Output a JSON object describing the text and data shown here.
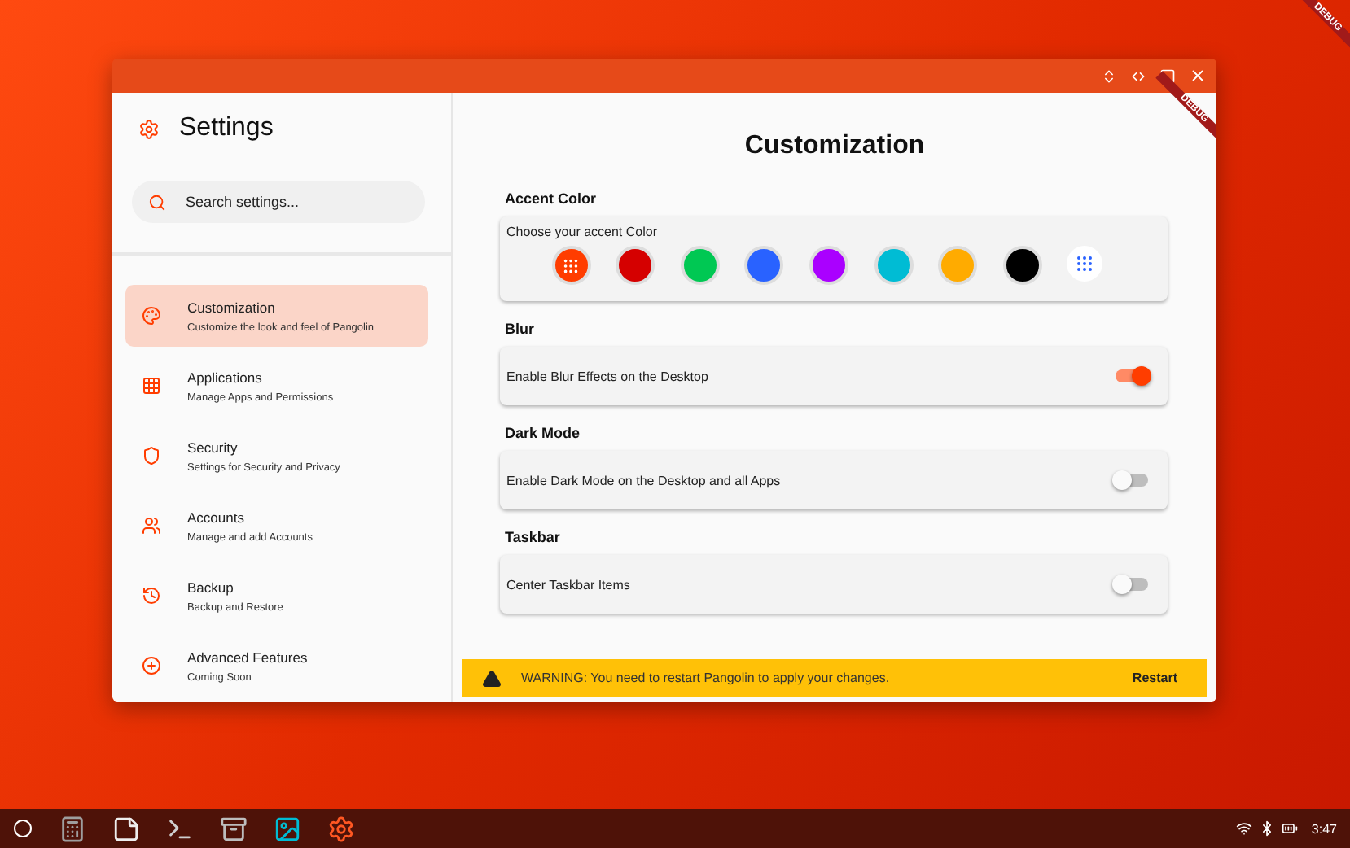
{
  "debug_banners": [
    "DEBUG",
    "DEBUG"
  ],
  "window": {
    "title": "Settings"
  },
  "search": {
    "placeholder": "Search settings..."
  },
  "sidebar": {
    "items": [
      {
        "kind": "palette",
        "title": "Customization",
        "subtitle": "Customize the look and feel of Pangolin",
        "selected": true
      },
      {
        "kind": "apps",
        "title": "Applications",
        "subtitle": "Manage Apps and Permissions",
        "selected": false
      },
      {
        "kind": "shield",
        "title": "Security",
        "subtitle": "Settings for Security and Privacy",
        "selected": false
      },
      {
        "kind": "people",
        "title": "Accounts",
        "subtitle": "Manage and add Accounts",
        "selected": false
      },
      {
        "kind": "backup",
        "title": "Backup",
        "subtitle": "Backup and Restore",
        "selected": false
      },
      {
        "kind": "plus",
        "title": "Advanced Features",
        "subtitle": "Coming Soon",
        "selected": false
      }
    ]
  },
  "page": {
    "title": "Customization"
  },
  "sections": [
    {
      "heading": "Accent Color",
      "kind": "colors",
      "label": "Choose your accent Color",
      "colors": [
        {
          "color": "#ff3d00",
          "selected": true
        },
        {
          "color": "#d50000",
          "selected": false
        },
        {
          "color": "#00c853",
          "selected": false
        },
        {
          "color": "#2962ff",
          "selected": false
        },
        {
          "color": "#aa00ff",
          "selected": false
        },
        {
          "color": "#00bcd4",
          "selected": false
        },
        {
          "color": "#ffab00",
          "selected": false
        },
        {
          "color": "#000000",
          "selected": false
        }
      ]
    },
    {
      "heading": "Blur",
      "kind": "toggle",
      "label": "Enable Blur Effects on the Desktop",
      "on": true
    },
    {
      "heading": "Dark Mode",
      "kind": "toggle",
      "label": "Enable Dark Mode on the Desktop and all Apps",
      "on": false
    },
    {
      "heading": "Taskbar",
      "kind": "toggle",
      "label": "Center Taskbar Items",
      "on": false
    }
  ],
  "warning": {
    "text": "WARNING: You need to restart Pangolin to apply your changes.",
    "action": "Restart"
  },
  "taskbar": {
    "apps": [
      {
        "kind": "calculator"
      },
      {
        "kind": "notes"
      },
      {
        "kind": "terminal"
      },
      {
        "kind": "files"
      },
      {
        "kind": "media"
      },
      {
        "kind": "settings"
      }
    ],
    "time": "3:47"
  }
}
